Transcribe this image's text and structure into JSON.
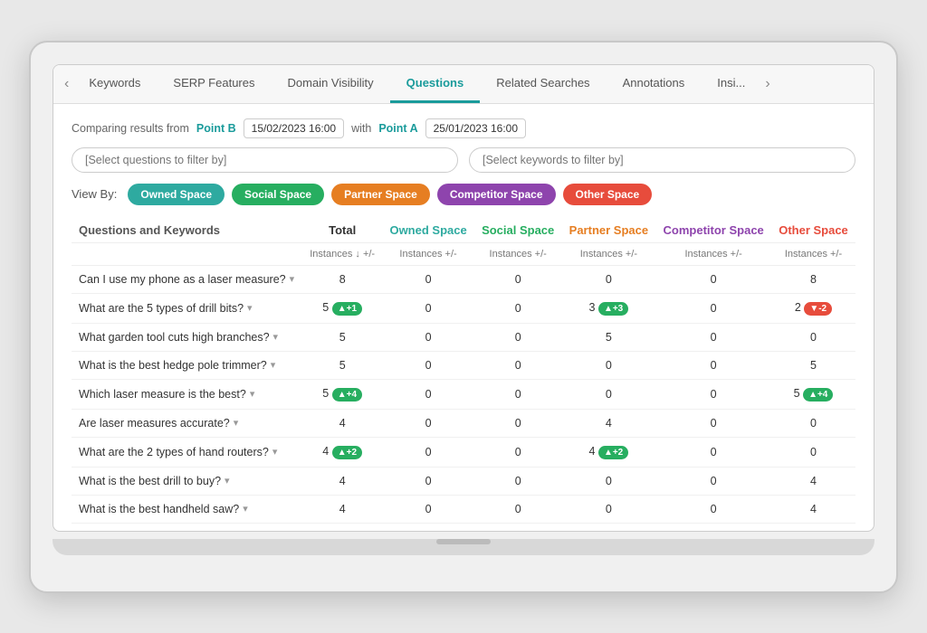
{
  "tabs": [
    {
      "label": "Keywords",
      "active": false
    },
    {
      "label": "SERP Features",
      "active": false
    },
    {
      "label": "Domain Visibility",
      "active": false
    },
    {
      "label": "Questions",
      "active": true
    },
    {
      "label": "Related Searches",
      "active": false
    },
    {
      "label": "Annotations",
      "active": false
    },
    {
      "label": "Insi...",
      "active": false
    }
  ],
  "compare": {
    "prefix": "Comparing results from",
    "point_b_label": "Point B",
    "point_b_date": "15/02/2023 16:00",
    "with": "with",
    "point_a_label": "Point A",
    "point_a_date": "25/01/2023 16:00"
  },
  "filters": {
    "questions_placeholder": "[Select questions to filter by]",
    "keywords_placeholder": "[Select keywords to filter by]"
  },
  "view_by": {
    "label": "View By:",
    "buttons": [
      {
        "label": "Owned Space",
        "class": "btn-owned"
      },
      {
        "label": "Social Space",
        "class": "btn-social"
      },
      {
        "label": "Partner Space",
        "class": "btn-partner"
      },
      {
        "label": "Competitor Space",
        "class": "btn-competitor"
      },
      {
        "label": "Other Space",
        "class": "btn-other"
      }
    ]
  },
  "table": {
    "col_headers": [
      "Questions and Keywords",
      "Total",
      "Owned Space",
      "Social Space",
      "Partner Space",
      "Competitor Space",
      "Other Space"
    ],
    "sub_headers": [
      "",
      "Instances ↓ +/-",
      "Instances +/-",
      "Instances +/-",
      "Instances +/-",
      "Instances +/-",
      "Instances +/-"
    ],
    "rows": [
      {
        "question": "Can I use my phone as a laser measure?",
        "total": "8",
        "total_badge": null,
        "owned": "0",
        "owned_badge": null,
        "social": "0",
        "social_badge": null,
        "partner": "0",
        "partner_badge": null,
        "competitor": "0",
        "competitor_badge": null,
        "other": "8",
        "other_badge": null
      },
      {
        "question": "What are the 5 types of drill bits?",
        "total": "5",
        "total_badge": {
          "type": "up",
          "val": "+1"
        },
        "owned": "0",
        "owned_badge": null,
        "social": "0",
        "social_badge": null,
        "partner": "3",
        "partner_badge": {
          "type": "up",
          "val": "+3"
        },
        "competitor": "0",
        "competitor_badge": null,
        "other": "2",
        "other_badge": {
          "type": "down",
          "val": "-2"
        }
      },
      {
        "question": "What garden tool cuts high branches?",
        "total": "5",
        "total_badge": null,
        "owned": "0",
        "owned_badge": null,
        "social": "0",
        "social_badge": null,
        "partner": "5",
        "partner_badge": null,
        "competitor": "0",
        "competitor_badge": null,
        "other": "0",
        "other_badge": null
      },
      {
        "question": "What is the best hedge pole trimmer?",
        "total": "5",
        "total_badge": null,
        "owned": "0",
        "owned_badge": null,
        "social": "0",
        "social_badge": null,
        "partner": "0",
        "partner_badge": null,
        "competitor": "0",
        "competitor_badge": null,
        "other": "5",
        "other_badge": null
      },
      {
        "question": "Which laser measure is the best?",
        "total": "5",
        "total_badge": {
          "type": "up",
          "val": "+4"
        },
        "owned": "0",
        "owned_badge": null,
        "social": "0",
        "social_badge": null,
        "partner": "0",
        "partner_badge": null,
        "competitor": "0",
        "competitor_badge": null,
        "other": "5",
        "other_badge": {
          "type": "up",
          "val": "+4"
        }
      },
      {
        "question": "Are laser measures accurate?",
        "total": "4",
        "total_badge": null,
        "owned": "0",
        "owned_badge": null,
        "social": "0",
        "social_badge": null,
        "partner": "4",
        "partner_badge": null,
        "competitor": "0",
        "competitor_badge": null,
        "other": "0",
        "other_badge": null
      },
      {
        "question": "What are the 2 types of hand routers?",
        "total": "4",
        "total_badge": {
          "type": "up",
          "val": "+2"
        },
        "owned": "0",
        "owned_badge": null,
        "social": "0",
        "social_badge": null,
        "partner": "4",
        "partner_badge": {
          "type": "up",
          "val": "+2"
        },
        "competitor": "0",
        "competitor_badge": null,
        "other": "0",
        "other_badge": null
      },
      {
        "question": "What is the best drill to buy?",
        "total": "4",
        "total_badge": null,
        "owned": "0",
        "owned_badge": null,
        "social": "0",
        "social_badge": null,
        "partner": "0",
        "partner_badge": null,
        "competitor": "0",
        "competitor_badge": null,
        "other": "4",
        "other_badge": null
      },
      {
        "question": "What is the best handheld saw?",
        "total": "4",
        "total_badge": null,
        "owned": "0",
        "owned_badge": null,
        "social": "0",
        "social_badge": null,
        "partner": "0",
        "partner_badge": null,
        "competitor": "0",
        "competitor_badge": null,
        "other": "4",
        "other_badge": null
      }
    ]
  },
  "nav": {
    "prev": "‹",
    "next": "›"
  }
}
